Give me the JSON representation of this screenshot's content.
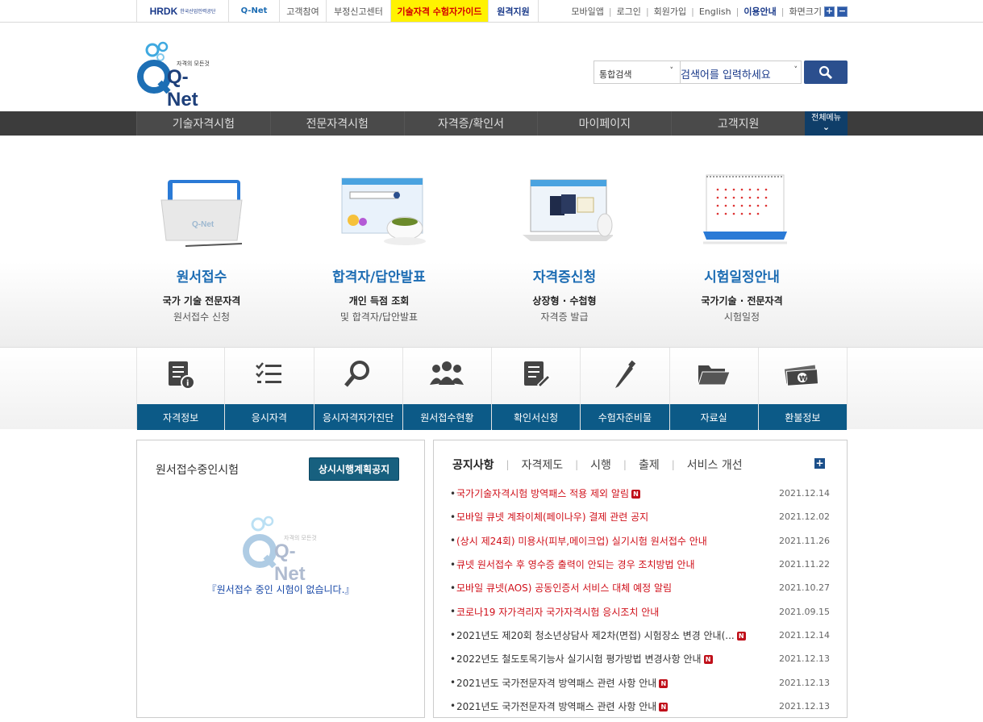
{
  "topbar": {
    "hrdk_logo": "HRDK",
    "hrdk_sub": "한국산업인력공단",
    "qnet_logo": "Q-Net",
    "links": [
      "고객참여",
      "부정신고센터"
    ],
    "guide": "기술자격 수험자가이드",
    "support": "원격지원",
    "right": [
      "모바일앱",
      "로그인",
      "회원가입",
      "English",
      "이용안내",
      "화면크기"
    ],
    "zoom_in": "+",
    "zoom_out": "−"
  },
  "header": {
    "logo_text": "Q-Net",
    "logo_tagline": "자격의 모든것",
    "search": {
      "select_value": "통합검색",
      "placeholder": "검색어를 입력하세요"
    }
  },
  "gnb": {
    "items": [
      "기술자격시험",
      "전문자격시험",
      "자격증/확인서",
      "마이페이지",
      "고객지원"
    ],
    "all_menu": "전체메뉴"
  },
  "hero": [
    {
      "title": "원서접수",
      "sub1": "국가 기술 전문자격",
      "sub2": "원서접수 신청"
    },
    {
      "title": "합격자/답안발표",
      "sub1": "개인 득점 조회",
      "sub2": "및 합격자/답안발표"
    },
    {
      "title": "자격증신청",
      "sub1": "상장형 · 수첩형",
      "sub2": "자격증 발급"
    },
    {
      "title": "시험일정안내",
      "sub1": "국가기술 · 전문자격",
      "sub2": "시험일정"
    }
  ],
  "quick": [
    {
      "label": "자격정보",
      "icon": "document-info-icon"
    },
    {
      "label": "응시자격",
      "icon": "checklist-icon"
    },
    {
      "label": "응시자격자가진단",
      "icon": "magnifier-icon"
    },
    {
      "label": "원서접수현황",
      "icon": "people-icon"
    },
    {
      "label": "확인서신청",
      "icon": "document-pen-icon"
    },
    {
      "label": "수험자준비물",
      "icon": "pencil-icon"
    },
    {
      "label": "자료실",
      "icon": "folder-icon"
    },
    {
      "label": "환불정보",
      "icon": "money-icon"
    }
  ],
  "left_box": {
    "title": "원서접수중인시험",
    "button": "상시시행계획공지",
    "empty_message": "『원서접수 중인 시험이 없습니다.』"
  },
  "notice": {
    "tabs": [
      "공지사항",
      "자격제도",
      "시행",
      "출제",
      "서비스 개선"
    ],
    "more": "+",
    "items": [
      {
        "title": "국가기술자격시험 방역패스 적용 제외 알림",
        "date": "2021.12.14",
        "red": true,
        "new": true
      },
      {
        "title": "모바일 큐넷 계좌이체(페이나우) 결제 관련 공지",
        "date": "2021.12.02",
        "red": true,
        "new": false
      },
      {
        "title": "(상시 제24회) 미용사(피부,메이크업) 실기시험 원서접수 안내",
        "date": "2021.11.26",
        "red": true,
        "new": false
      },
      {
        "title": "큐넷 원서접수 후 영수증 출력이 안되는 경우 조치방법 안내",
        "date": "2021.11.22",
        "red": true,
        "new": false
      },
      {
        "title": "모바일 큐넷(AOS) 공동인증서 서비스 대체 예정 알림",
        "date": "2021.10.27",
        "red": true,
        "new": false
      },
      {
        "title": "코로나19 자가격리자 국가자격시험 응시조치 안내",
        "date": "2021.09.15",
        "red": true,
        "new": false
      },
      {
        "title": "2021년도 제20회 청소년상담사 제2차(면접) 시험장소 변경 안내(...",
        "date": "2021.12.14",
        "red": false,
        "new": true
      },
      {
        "title": "2022년도 철도토목기능사 실기시험 평가방법 변경사항 안내",
        "date": "2021.12.13",
        "red": false,
        "new": true
      },
      {
        "title": "2021년도 국가전문자격 방역패스 관련 사항 안내",
        "date": "2021.12.13",
        "red": false,
        "new": true
      },
      {
        "title": "2021년도 국가전문자격 방역패스 관련 사항 안내",
        "date": "2021.12.13",
        "red": false,
        "new": true
      }
    ],
    "new_badge": "N"
  },
  "colors": {
    "brand_blue": "#1c6cb3",
    "quick_bar": "#0c5a87",
    "gnb_bg": "#3c3c3c",
    "notice_red": "#d0101a"
  }
}
